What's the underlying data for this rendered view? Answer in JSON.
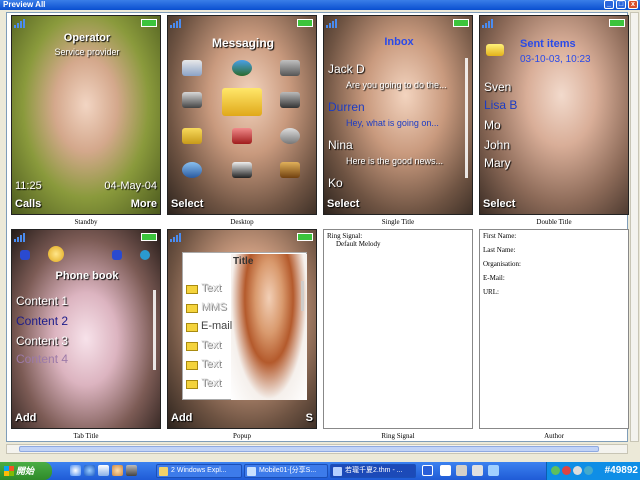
{
  "window": {
    "title": "Preview All",
    "minimize": "_",
    "maximize": "□",
    "close": "x"
  },
  "screens": {
    "standby": {
      "caption": "Standby",
      "operator": "Operator",
      "provider": "Service provider",
      "time": "11:25",
      "date": "04-May-04",
      "left_soft": "Calls",
      "right_soft": "More"
    },
    "desktop": {
      "caption": "Desktop",
      "title": "Messaging",
      "left_soft": "Select",
      "icons": [
        "phonebook-icon",
        "internet-icon",
        "camera-icon",
        "camera-icon",
        "messaging-icon",
        "radio-icon",
        "file-manager-icon",
        "calendar-icon",
        "settings-icon",
        "connectivity-icon",
        "organizer-icon",
        "tools-icon"
      ]
    },
    "single_title": {
      "caption": "Single Title",
      "title": "Inbox",
      "items": [
        {
          "name": "Jack D",
          "preview": "Are you going to do the..."
        },
        {
          "name": "Durren",
          "preview": "Hey, what is going on..."
        },
        {
          "name": "Nina",
          "preview": "Here is the good news..."
        },
        {
          "name": "Ko",
          "preview": ""
        }
      ],
      "left_soft": "Select"
    },
    "double_title": {
      "caption": "Double Title",
      "title": "Sent items",
      "subtitle": "03-10-03, 10:23",
      "items": [
        "Sven",
        "Lisa B",
        "Mo",
        "John",
        "Mary"
      ],
      "left_soft": "Select"
    },
    "tab_title": {
      "caption": "Tab Title",
      "title": "Phone book",
      "items": [
        "Content 1",
        "Content 2",
        "Content 3",
        "Content 4"
      ],
      "left_soft": "Add"
    },
    "popup": {
      "caption": "Popup",
      "title": "Title",
      "items": [
        "Text",
        "MMS",
        "E-mail",
        "Text",
        "Text",
        "Text"
      ],
      "left_soft": "Add",
      "right_soft": "S"
    },
    "ring_signal": {
      "caption": "Ring Signal",
      "label": "Ring Signal:",
      "value": "Default Melody"
    },
    "author": {
      "caption": "Author",
      "fields": [
        "First Name:",
        "Last Name:",
        "Organisation:",
        "E-Mail:",
        "URL:"
      ]
    }
  },
  "taskbar": {
    "start": "開始",
    "tasks": [
      {
        "label": "2 Windows Expl...",
        "active": false
      },
      {
        "label": "Mobile01-[分享S...",
        "active": false
      },
      {
        "label": "若瓏千夏2.thm - ...",
        "active": true
      }
    ],
    "clock": "#49892"
  },
  "colors": {
    "accent_blue": "#1c3cc4",
    "battery_green": "#3cc43c",
    "taskbar_blue": "#1f5bd6"
  }
}
